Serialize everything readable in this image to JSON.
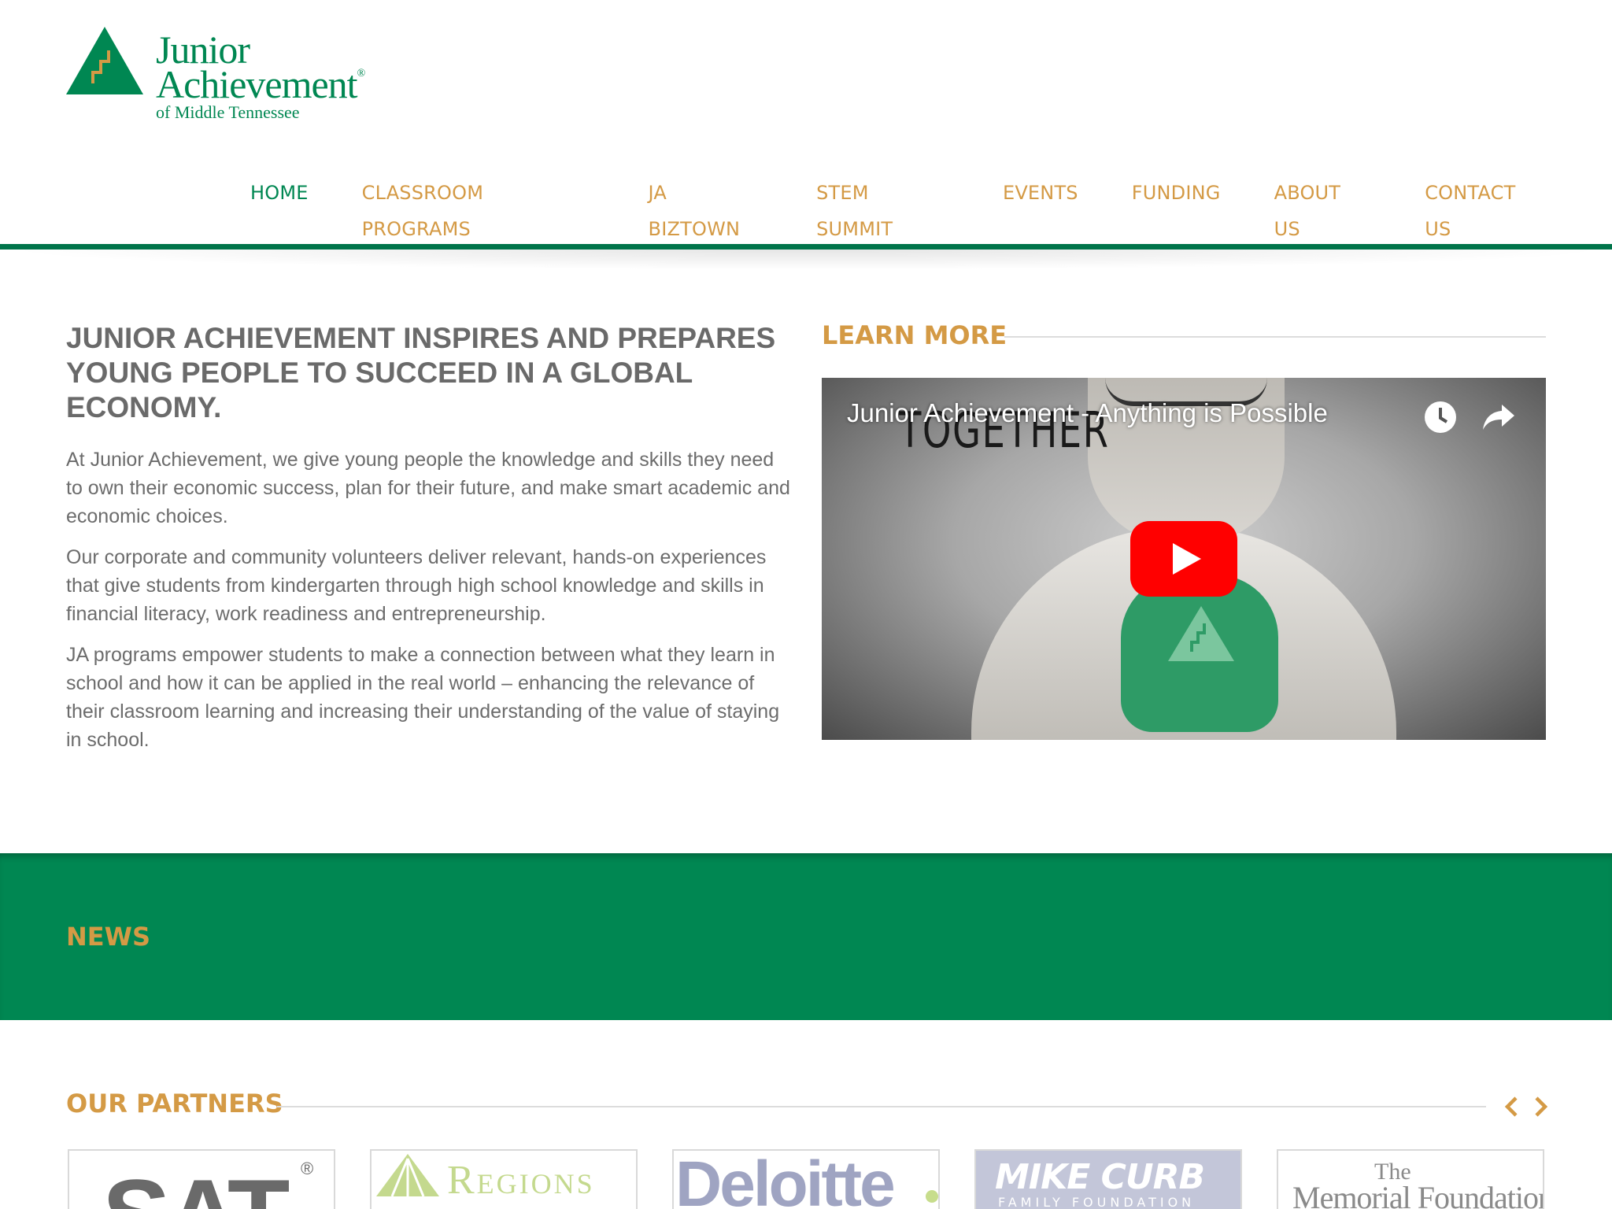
{
  "logo": {
    "line1": "Junior",
    "line2": "Achievement",
    "registered": "®",
    "line3": "of Middle Tennessee"
  },
  "nav": {
    "items": [
      "HOME",
      "CLASSROOM PROGRAMS",
      "JA BIZTOWN",
      "STEM SUMMIT",
      "EVENTS",
      "FUNDING",
      "ABOUT US",
      "CONTACT US"
    ],
    "active": "HOME"
  },
  "intro": {
    "title": "JUNIOR ACHIEVEMENT INSPIRES AND PREPARES YOUNG PEOPLE TO SUCCEED IN A GLOBAL ECONOMY.",
    "paragraphs": [
      "At Junior Achievement, we give young people the knowledge and skills they need to own their economic success, plan for their future, and make smart academic and economic choices.",
      "Our corporate and community volunteers deliver relevant, hands-on experiences that give students from kindergarten through high school knowledge and skills in financial literacy, work readiness and entrepreneurship.",
      "JA programs empower students to make a connection between what they learn in school and how it can be applied in the real world – enhancing the relevance of their classroom learning and increasing their understanding of the value of staying in school."
    ]
  },
  "learn_more": {
    "title": "LEARN MORE",
    "video": {
      "title": "Junior Achievement - Anything is Possible",
      "thumbnail_text": "TOGETHER",
      "watch_later_icon": "clock-icon",
      "share_icon": "share-icon",
      "play_icon": "play-icon"
    }
  },
  "news": {
    "title": "NEWS"
  },
  "partners": {
    "title": "OUR PARTNERS",
    "prev_icon": "chevron-left-icon",
    "next_icon": "chevron-right-icon",
    "logos": [
      {
        "text": "SAT",
        "suffix": "®"
      },
      {
        "text": "Regions"
      },
      {
        "text": "Deloitte"
      },
      {
        "text": "MIKE CURB",
        "subtext": "FAMILY FOUNDATION"
      },
      {
        "text": "Memorial Foundation",
        "prefix": "The"
      }
    ]
  },
  "colors": {
    "brand_green": "#008752",
    "accent_gold": "#d49a45",
    "body_text": "#6c6c6c",
    "youtube_red": "#ff0000"
  }
}
